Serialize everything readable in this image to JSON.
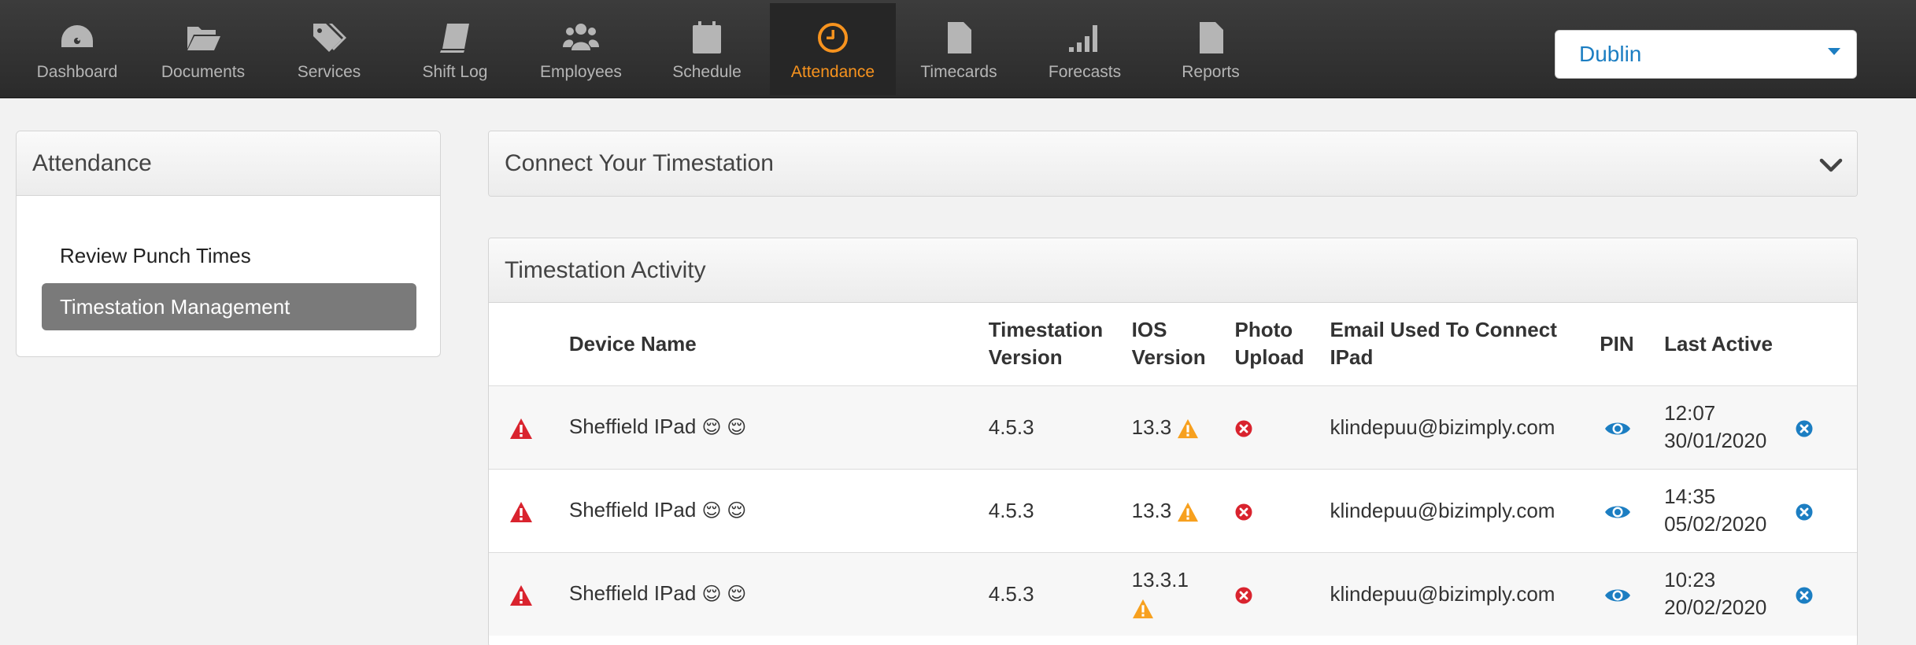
{
  "nav": {
    "items": [
      {
        "label": "Dashboard",
        "icon": "dashboard-icon"
      },
      {
        "label": "Documents",
        "icon": "folder-icon"
      },
      {
        "label": "Services",
        "icon": "tags-icon"
      },
      {
        "label": "Shift Log",
        "icon": "book-icon"
      },
      {
        "label": "Employees",
        "icon": "users-icon"
      },
      {
        "label": "Schedule",
        "icon": "calendar-icon"
      },
      {
        "label": "Attendance",
        "icon": "clock-icon"
      },
      {
        "label": "Timecards",
        "icon": "document-icon"
      },
      {
        "label": "Forecasts",
        "icon": "signal-bars-icon"
      },
      {
        "label": "Reports",
        "icon": "file-icon"
      }
    ],
    "active": "Attendance",
    "active_color": "#f7931e"
  },
  "location": {
    "selected": "Dublin",
    "color": "#1c7ec2"
  },
  "sidebar": {
    "title": "Attendance",
    "items": [
      {
        "label": "Review Punch Times"
      },
      {
        "label": "Timestation Management"
      }
    ],
    "active": "Timestation Management"
  },
  "connect": {
    "title": "Connect Your Timestation"
  },
  "activity": {
    "title": "Timestation Activity",
    "columns": {
      "device": "Device Name",
      "ts_version_1": "Timestation",
      "ts_version_2": "Version",
      "ios_1": "IOS",
      "ios_2": "Version",
      "photo_1": "Photo",
      "photo_2": "Upload",
      "email_1": "Email Used To Connect",
      "email_2": "IPad",
      "pin": "PIN",
      "last_active": "Last Active"
    },
    "rows": [
      {
        "device": "Sheffield IPad",
        "emoji": "😌 😌",
        "ts_version": "4.5.3",
        "ios": "13.3",
        "email": "klindepuu@bizimply.com",
        "time": "12:07",
        "date": "30/01/2020"
      },
      {
        "device": "Sheffield IPad",
        "emoji": "😌 😌",
        "ts_version": "4.5.3",
        "ios": "13.3",
        "email": "klindepuu@bizimply.com",
        "time": "14:35",
        "date": "05/02/2020"
      },
      {
        "device": "Sheffield IPad",
        "emoji": "😌 😌",
        "ts_version": "4.5.3",
        "ios": "13.3.1",
        "email": "klindepuu@bizimply.com",
        "time": "10:23",
        "date": "20/02/2020"
      }
    ]
  },
  "colors": {
    "alert_red": "#d9232e",
    "warning_orange": "#f7a01e",
    "action_blue": "#1c7ec2"
  }
}
